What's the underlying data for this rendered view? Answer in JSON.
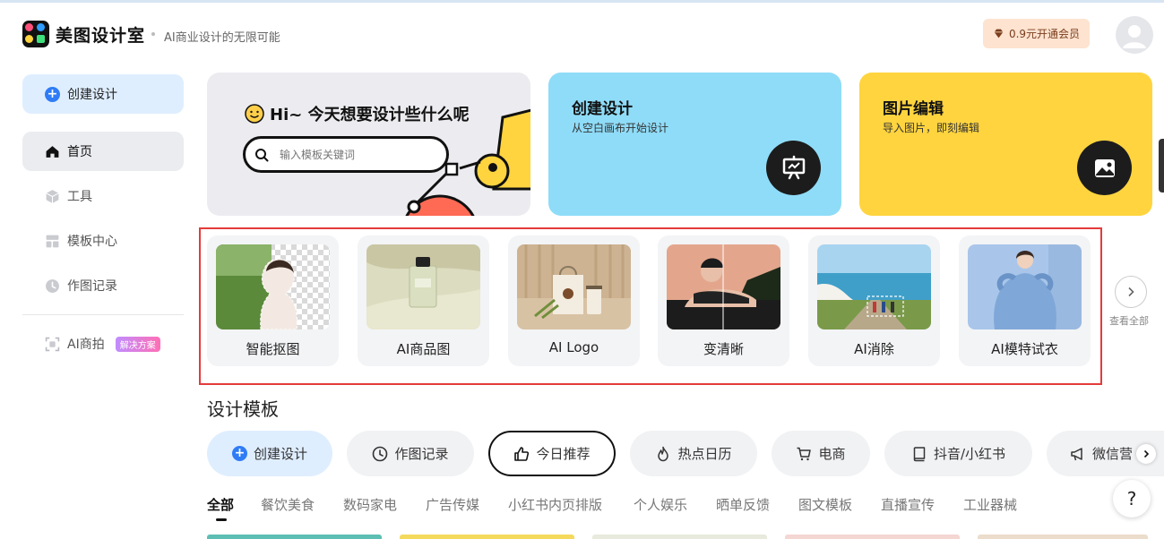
{
  "header": {
    "brand": "美图设计室",
    "slogan": "AI商业设计的无限可能",
    "vip_label": "0.9元开通会员"
  },
  "sidebar": {
    "create_label": "创建设计",
    "items": [
      {
        "label": "首页",
        "icon": "home-icon",
        "active": true
      },
      {
        "label": "工具",
        "icon": "cube-icon"
      },
      {
        "label": "模板中心",
        "icon": "template-icon"
      },
      {
        "label": "作图记录",
        "icon": "clock-icon"
      }
    ],
    "ai_shoot": {
      "label": "AI商拍",
      "badge": "解决方案"
    }
  },
  "hero": {
    "greeting": "Hi~ 今天想要设计些什么呢",
    "search_placeholder": "输入模板关键词",
    "cards": [
      {
        "title": "创建设计",
        "subtitle": "从空白画布开始设计",
        "color": "#8fdcf8",
        "icon": "easel-icon"
      },
      {
        "title": "图片编辑",
        "subtitle": "导入图片，即刻编辑",
        "color": "#ffd43f",
        "icon": "image-icon"
      }
    ]
  },
  "ai_tools": {
    "items": [
      {
        "label": "智能抠图"
      },
      {
        "label": "AI商品图"
      },
      {
        "label": "AI Logo"
      },
      {
        "label": "变清晰"
      },
      {
        "label": "AI消除"
      },
      {
        "label": "AI模特试衣"
      }
    ],
    "see_all": "查看全部"
  },
  "templates": {
    "title": "设计模板",
    "pills": [
      {
        "label": "创建设计",
        "icon": "plus-circle-icon"
      },
      {
        "label": "作图记录",
        "icon": "clock-icon"
      },
      {
        "label": "今日推荐",
        "icon": "thumbs-up-icon"
      },
      {
        "label": "热点日历",
        "icon": "flame-icon"
      },
      {
        "label": "电商",
        "icon": "cart-icon"
      },
      {
        "label": "抖音/小红书",
        "icon": "book-icon"
      },
      {
        "label": "微信营",
        "icon": "megaphone-icon"
      }
    ],
    "categories": [
      "全部",
      "餐饮美食",
      "数码家电",
      "广告传媒",
      "小红书内页排版",
      "个人娱乐",
      "晒单反馈",
      "图文模板",
      "直播宣传",
      "工业器械"
    ],
    "help": "?"
  }
}
